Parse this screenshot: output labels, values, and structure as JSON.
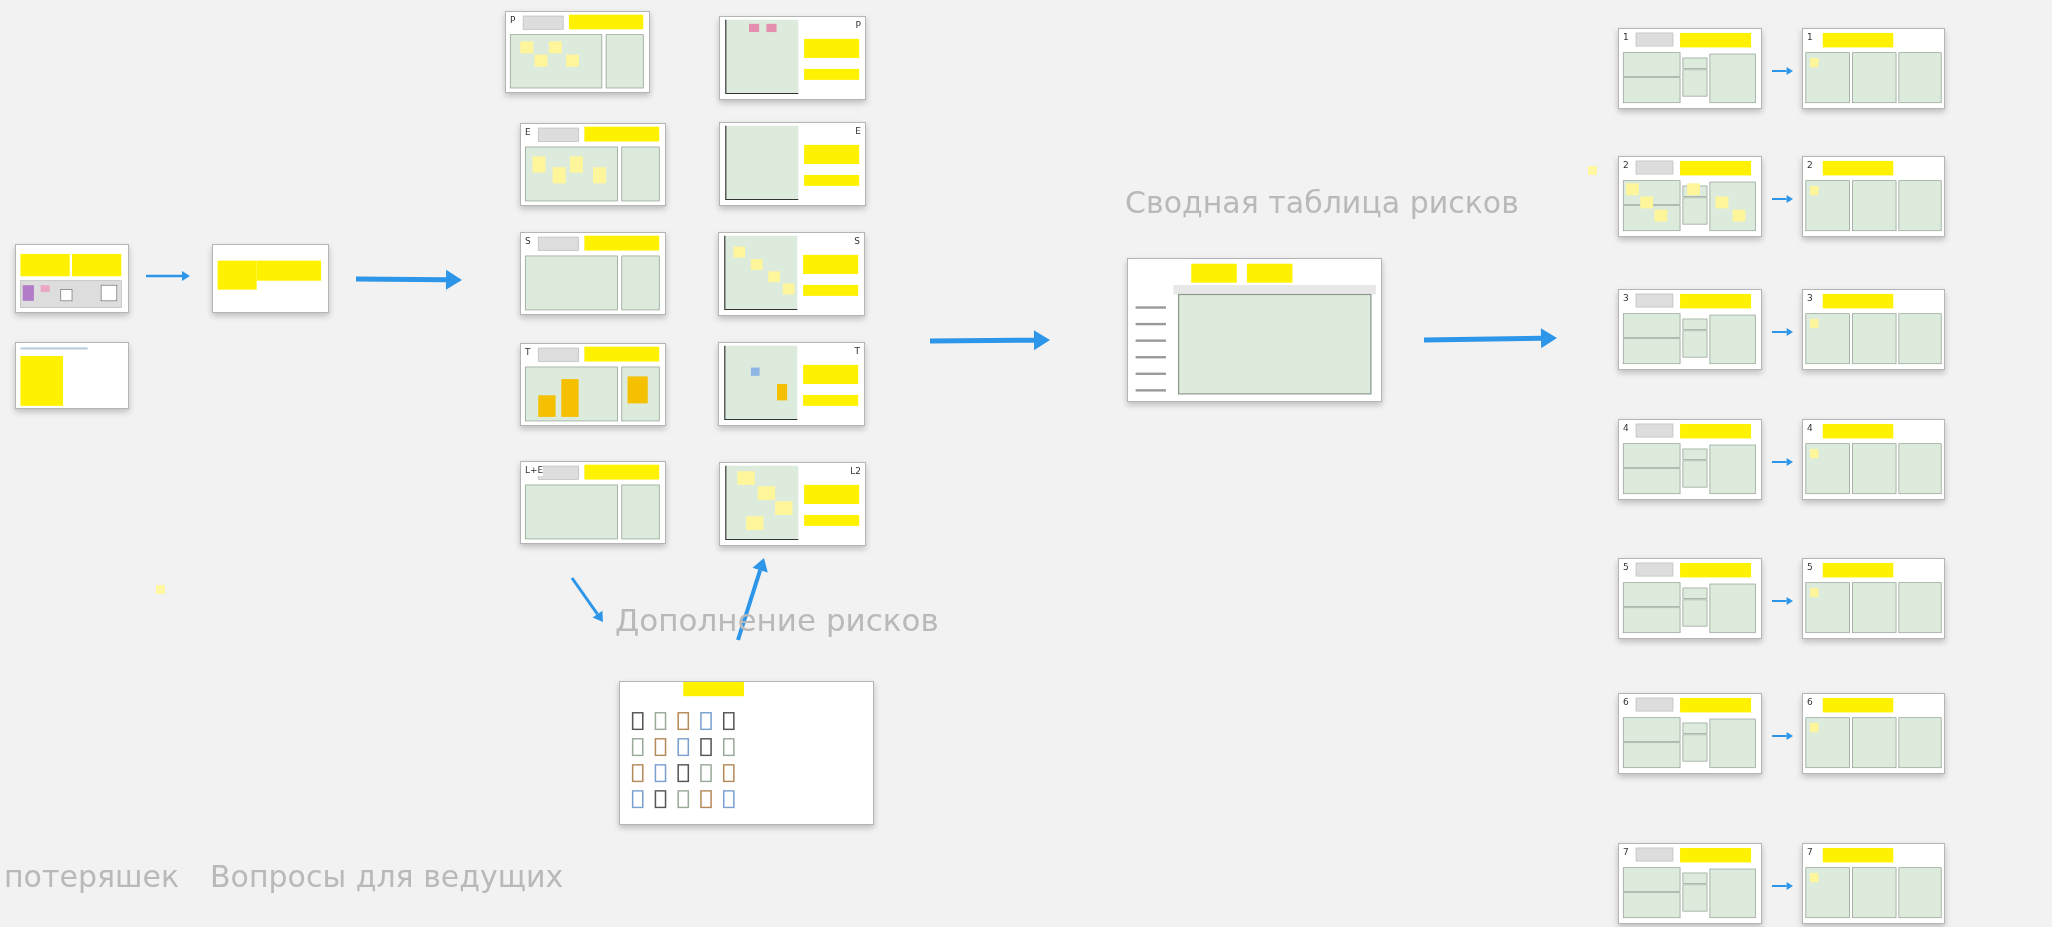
{
  "left_group": {
    "frames": [
      {
        "kind": "intro"
      },
      {
        "kind": "notes"
      },
      {
        "kind": "brief"
      }
    ]
  },
  "pestle": {
    "frames": [
      {
        "kind": "pest",
        "label": "P"
      },
      {
        "kind": "pest",
        "label": "E"
      },
      {
        "kind": "pest",
        "label": "S"
      },
      {
        "kind": "pest",
        "label": "T"
      },
      {
        "kind": "pest",
        "label": "L+E"
      },
      {
        "kind": "chart",
        "label": "P"
      },
      {
        "kind": "chart",
        "label": "E"
      },
      {
        "kind": "chart",
        "label": "S"
      },
      {
        "kind": "chart",
        "label": "T"
      },
      {
        "kind": "chart",
        "label": "L2"
      }
    ]
  },
  "risk_addition": {
    "title": "Дополнение рисков",
    "frame": {
      "kind": "icons"
    }
  },
  "summary": {
    "title": "Сводная таблица рисков",
    "frame": {
      "kind": "summary"
    }
  },
  "action_plans": {
    "rows": [
      {
        "analysis": {
          "kind": "plan_left",
          "label": "1"
        },
        "plan": {
          "kind": "plan_right",
          "label": "1"
        }
      },
      {
        "analysis": {
          "kind": "plan_left",
          "label": "2"
        },
        "plan": {
          "kind": "plan_right",
          "label": "2"
        }
      },
      {
        "analysis": {
          "kind": "plan_left",
          "label": "3"
        },
        "plan": {
          "kind": "plan_right",
          "label": "3"
        }
      },
      {
        "analysis": {
          "kind": "plan_left",
          "label": "4"
        },
        "plan": {
          "kind": "plan_right",
          "label": "4"
        }
      },
      {
        "analysis": {
          "kind": "plan_left",
          "label": "5"
        },
        "plan": {
          "kind": "plan_right",
          "label": "5"
        }
      },
      {
        "analysis": {
          "kind": "plan_left",
          "label": "6"
        },
        "plan": {
          "kind": "plan_right",
          "label": "6"
        }
      },
      {
        "analysis": {
          "kind": "plan_left",
          "label": "7"
        },
        "plan": {
          "kind": "plan_right",
          "label": "7"
        }
      }
    ]
  },
  "bottom_titles": [
    {
      "text": "потеряшек"
    },
    {
      "text": "Вопросы для ведущих"
    }
  ]
}
